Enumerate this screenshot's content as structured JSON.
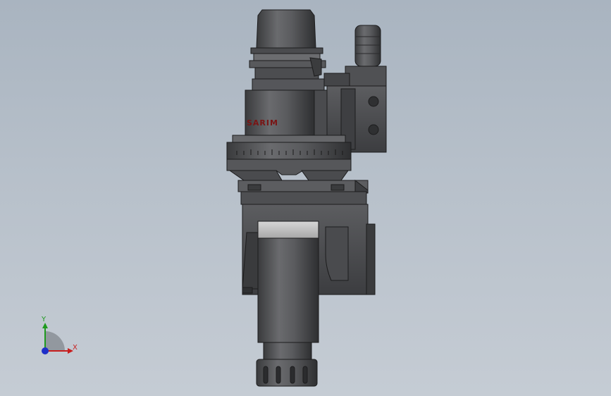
{
  "model": {
    "brand_text": "SARIM",
    "colors": {
      "background_top": "#a9b4c0",
      "background_bottom": "#c5ccd4",
      "body_dark": "#3f4042",
      "body_mid": "#5a5b5e",
      "body_light": "#7a7b7e",
      "highlight": "#c9c9c9",
      "brand_red": "#7a1414",
      "edge": "#1c1c1d"
    }
  },
  "triad": {
    "x_label": "X",
    "y_label": "Y",
    "colors": {
      "x": "#c81e1e",
      "y": "#1e9a1e",
      "z": "#1e2fc8",
      "arc": "#8a8f96"
    }
  }
}
